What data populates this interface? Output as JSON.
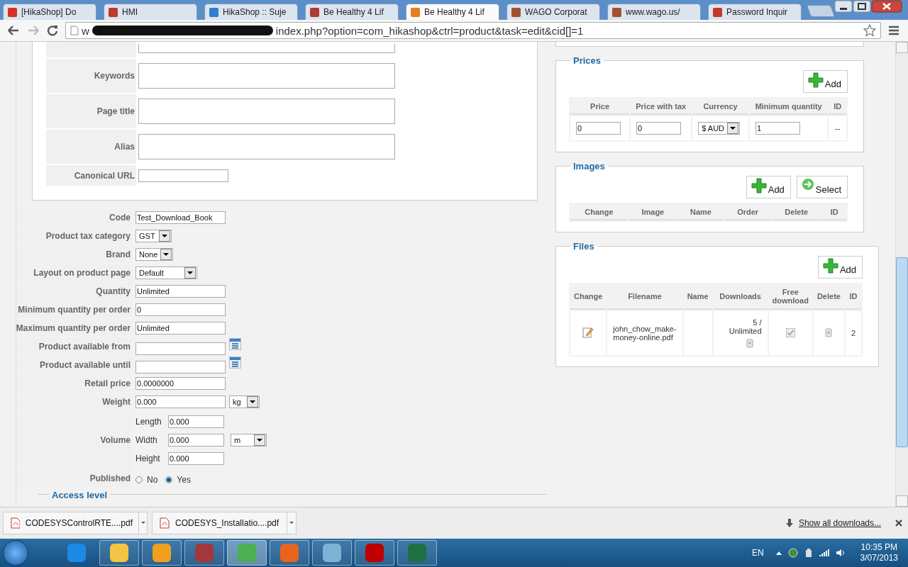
{
  "browser": {
    "tabs": [
      {
        "title": "[HikaShop] Do",
        "color": "#d93025",
        "selected": false
      },
      {
        "title": "HMI",
        "color": "#c0392b",
        "selected": false
      },
      {
        "title": "HikaShop :: Suje",
        "color": "#2c7fd1",
        "selected": false
      },
      {
        "title": "Be Healthy 4 Lif",
        "color": "#b03a2e",
        "selected": false
      },
      {
        "title": "Be Healthy 4 Lif",
        "color": "#e67e22",
        "selected": true
      },
      {
        "title": "WAGO Corporat",
        "color": "#a0522d",
        "selected": false
      },
      {
        "title": "www.wago.us/",
        "color": "#a0522d",
        "selected": false
      },
      {
        "title": "Password Inquir",
        "color": "#c0392b",
        "selected": false
      }
    ],
    "url_start": "w",
    "url": "index.php?option=com_hikashop&ctrl=product&task=edit&cid[]=1"
  },
  "seo_fields": [
    {
      "label": "Keywords",
      "kind": "textarea"
    },
    {
      "label": "Page title",
      "kind": "textarea"
    },
    {
      "label": "Alias",
      "kind": "textarea"
    },
    {
      "label": "Canonical URL",
      "kind": "input"
    }
  ],
  "product_fields": [
    {
      "label": "Code",
      "kind": "input",
      "value": "Test_Download_Book"
    },
    {
      "label": "Product tax category",
      "kind": "select",
      "value": "GST"
    },
    {
      "label": "Brand",
      "kind": "select",
      "value": "None"
    },
    {
      "label": "Layout on product page",
      "kind": "select",
      "value": "Default"
    },
    {
      "label": "Quantity",
      "kind": "input",
      "value": "Unlimited"
    },
    {
      "label": "Minimum quantity per order",
      "kind": "input",
      "value": "0"
    },
    {
      "label": "Maximum quantity per order",
      "kind": "input",
      "value": "Unlimited"
    },
    {
      "label": "Product available from",
      "kind": "date"
    },
    {
      "label": "Product available until",
      "kind": "date"
    },
    {
      "label": "Retail price",
      "kind": "input",
      "value": "0.0000000"
    },
    {
      "label": "Weight",
      "kind": "unit",
      "value": "0.000",
      "unit": "kg"
    },
    {
      "label": "Volume",
      "kind": "volume",
      "unit": "m",
      "dims": [
        {
          "label": "Length",
          "value": "0.000"
        },
        {
          "label": "Width",
          "value": "0.000"
        },
        {
          "label": "Height",
          "value": "0.000"
        }
      ]
    },
    {
      "label": "Published",
      "kind": "radio",
      "options": [
        {
          "label": "No",
          "selected": false
        },
        {
          "label": "Yes",
          "selected": true
        }
      ]
    }
  ],
  "access_level": {
    "legend": "Access level"
  },
  "prices": {
    "legend": "Prices",
    "add": "Add",
    "columns": [
      "Price",
      "Price with tax",
      "Currency",
      "Minimum quantity",
      "ID"
    ],
    "rows": [
      {
        "price": "0",
        "price_with_tax": "0",
        "currency": "$ AUD",
        "minimum_quantity": "1",
        "id": "--"
      }
    ]
  },
  "images": {
    "legend": "Images",
    "add": "Add",
    "select": "Select",
    "columns": [
      "Change",
      "Image",
      "Name",
      "Order",
      "Delete",
      "ID"
    ]
  },
  "files": {
    "legend": "Files",
    "add": "Add",
    "columns": [
      "Change",
      "Filename",
      "Name",
      "Downloads",
      "Free download",
      "Delete",
      "ID"
    ],
    "rows": [
      {
        "filename": "john_chow_make-money-online.pdf",
        "downloads": "5 / Unlimited",
        "free_download": true,
        "id": "2"
      }
    ]
  },
  "downloads": {
    "items": [
      {
        "name": "CODESYSControlRTE....pdf"
      },
      {
        "name": "CODESYS_Installatio....pdf"
      }
    ],
    "show_all": "Show all downloads..."
  },
  "taskbar": {
    "apps": [
      {
        "color": "#1e88e5",
        "running": false,
        "active": false
      },
      {
        "color": "#f4c542",
        "running": true,
        "active": false
      },
      {
        "color": "#f0a020",
        "running": true,
        "active": false
      },
      {
        "color": "#a4373a",
        "running": true,
        "active": false
      },
      {
        "color": "#4caf50",
        "running": true,
        "active": true
      },
      {
        "color": "#e8641c",
        "running": true,
        "active": false
      },
      {
        "color": "#7fb3d5",
        "running": true,
        "active": false
      },
      {
        "color": "#bf0000",
        "running": true,
        "active": false
      },
      {
        "color": "#1d7144",
        "running": true,
        "active": false
      }
    ],
    "language": "EN",
    "time": "10:35 PM",
    "date": "3/07/2013"
  }
}
